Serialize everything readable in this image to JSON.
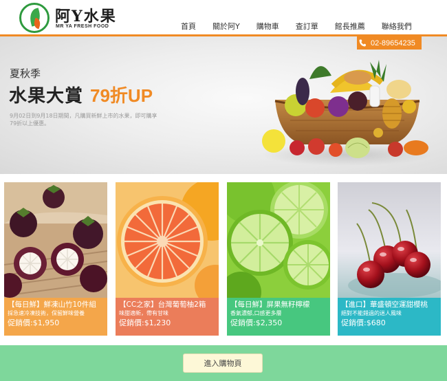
{
  "brand": {
    "name": "阿Y水果",
    "subtitle": "MR YA FRESH FOOD"
  },
  "nav": {
    "items": [
      "首頁",
      "關於阿Y",
      "購物車",
      "查訂單",
      "館長推薦",
      "聯絡我們"
    ]
  },
  "contact": {
    "phone": "02-89654235",
    "icon": "phone-icon"
  },
  "banner": {
    "season": "夏秋季",
    "title": "水果大賞",
    "highlight": "79折UP",
    "description": "9月02日到9月18日期間，凡購買新鮮上市的水果，即可購享79折以上優惠。"
  },
  "products": [
    {
      "name": "【每日鮮】鮮凍山竹10件組",
      "desc": "採急速冷凍技術，保留鮮味營養",
      "price": "促銷價:$1,950"
    },
    {
      "name": "【CC之家】台灣葡萄柚2箱",
      "desc": "味甜適新，帶有甘味",
      "price": "促銷價:$1,230"
    },
    {
      "name": "【每日鮮】屏果無籽檸檬",
      "desc": "香氣濃郁,口感更多層",
      "price": "促銷價:$2,350"
    },
    {
      "name": "【進口】華盛頓空運甜櫻桃",
      "desc": "絕對不能錯過的迷人風味",
      "price": "促銷價:$680"
    }
  ],
  "footer": {
    "button_label": "進入購物頁"
  },
  "colors": {
    "accent_orange": "#f08a24",
    "card1": "#f4a64a",
    "card2": "#eb7d5a",
    "card3": "#47c77f",
    "card4": "#2cb8c6",
    "footer_green": "#7ed79b",
    "button_bg": "#fdf8d7"
  }
}
